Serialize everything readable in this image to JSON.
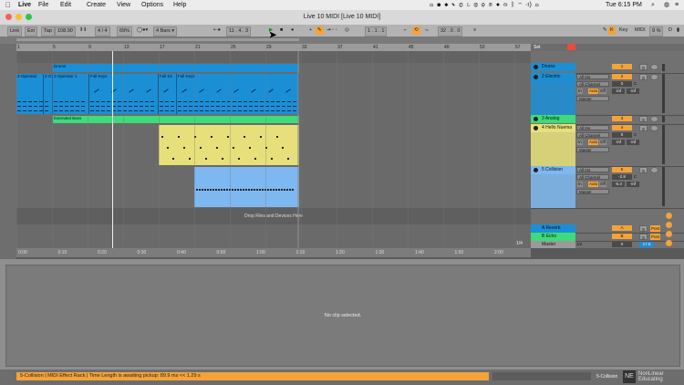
{
  "menubar": {
    "app": "Live",
    "items": [
      "File",
      "Edit",
      "Create",
      "View",
      "Options",
      "Help"
    ],
    "clock": "Tue 6:15 PM"
  },
  "window": {
    "title": "Live 10 MIDI  [Live 10 MIDI]"
  },
  "control": {
    "link": "Link",
    "ext": "Ext",
    "tap": "Tap",
    "tempo": "108.00",
    "sig_num": "4",
    "sig_den": "4",
    "groove": "69%",
    "quantize": "4 Bars",
    "position": [
      "11",
      "4",
      "3"
    ],
    "loop_start": [
      "1",
      "1",
      "1"
    ],
    "loop_len": [
      "32",
      "0",
      "0"
    ],
    "key_label": "Key",
    "midi_label": "MIDI",
    "cpu": "9 %",
    "d_label": "D"
  },
  "ruler": {
    "marks": [
      "1",
      "5",
      "9",
      "13",
      "17",
      "21",
      "25",
      "29",
      "33",
      "37",
      "41",
      "45",
      "49",
      "53",
      "57"
    ]
  },
  "timeruler": {
    "marks": [
      "0:00",
      "0:10",
      "0:20",
      "0:30",
      "0:40",
      "0:50",
      "1:00",
      "1:10",
      "1:20",
      "1:30",
      "1:40",
      "1:50",
      "2:00"
    ]
  },
  "page_indicator": "1/4",
  "clips": {
    "drums": "Drums",
    "electric": [
      "2-Operator",
      "2-O",
      "2-Operator 1",
      "Full Keys",
      "Full Ke",
      "Full Keys"
    ],
    "bass": "Extended Bass",
    "drop": "Drop Files and Devices Here"
  },
  "set_label": "Set",
  "tracks": [
    {
      "name": "Drums",
      "color": "#1b8fd6",
      "num": "1"
    },
    {
      "name": "2 Electric",
      "color": "#1b8fd6",
      "num": "2",
      "input": "All Ins",
      "channel": "All Channel",
      "monitor": [
        "In",
        "Auto",
        "Off"
      ],
      "output": "Master",
      "vol": "0",
      "pan": "C",
      "meter_a": "-inf",
      "meter_b": "-inf"
    },
    {
      "name": "3 Analog",
      "color": "#3ddb7a",
      "num": "3"
    },
    {
      "name": "4 Hello Nuema",
      "color": "#e7e07a",
      "num": "4",
      "input": "All Ins",
      "channel": "All Channel",
      "monitor": [
        "In",
        "Auto",
        "Off"
      ],
      "output": "Master",
      "vol": "0",
      "pan": "C",
      "meter_a": "-inf",
      "meter_b": "-inf"
    },
    {
      "name": "5 Collision",
      "color": "#7eb8f0",
      "num": "5",
      "input": "All Ins",
      "channel": "All Channel",
      "monitor": [
        "In",
        "Auto",
        "Off"
      ],
      "output": "Master",
      "vol": "-2.8",
      "pan": "C",
      "meter_a": "-5.3",
      "meter_b": "-inf"
    }
  ],
  "returns": [
    {
      "name": "A Reverb",
      "color": "#1b8fd6",
      "letter": "A",
      "post": "Post"
    },
    {
      "name": "B Echo",
      "color": "#3ddb7a",
      "letter": "B",
      "post": "Post"
    }
  ],
  "master": {
    "name": "Master",
    "sel": "1/2",
    "vol": "0",
    "meter": "17.5"
  },
  "detail": {
    "empty": "No clip selected."
  },
  "status": {
    "message": "5-Collision  |  MIDI Effect Rack  |  Time Length is awaiting pickup: 89.9 ms  <<  1.29 s",
    "track": "5-Collision"
  },
  "watermark": {
    "line1": "NonLinear",
    "line2": "Educating"
  },
  "colors": {
    "orange": "#f3a33a",
    "blue": "#1b8fd6",
    "green": "#3ddb7a",
    "yellow": "#e7e07a",
    "lightblue": "#7eb8f0"
  }
}
